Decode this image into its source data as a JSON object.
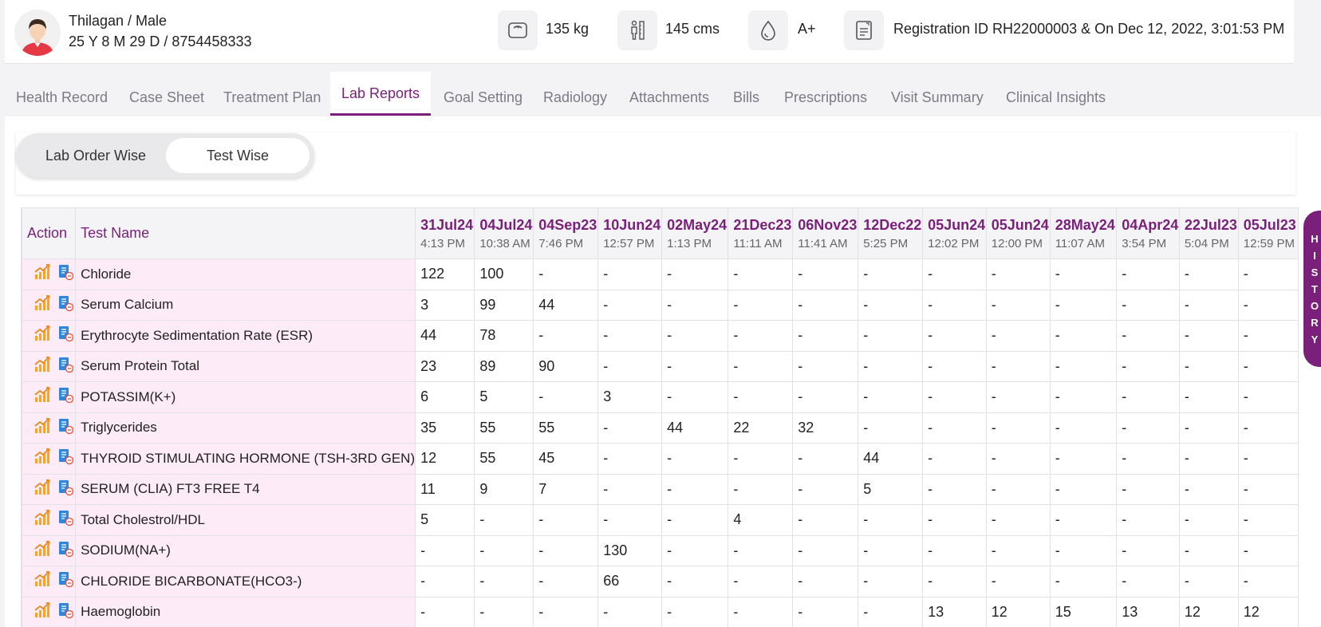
{
  "patient": {
    "name_gender": "Thilagan / Male",
    "age_phone": "25 Y 8 M 29 D / 8754458333"
  },
  "stats": {
    "weight": "135 kg",
    "height": "145 cms",
    "blood_group": "A+",
    "registration": "Registration ID RH22000003 & On Dec 12, 2022, 3:01:53 PM"
  },
  "tabs": [
    "Health Record",
    "Case Sheet",
    "Treatment Plan",
    "Lab Reports",
    "Goal Setting",
    "Radiology",
    "Attachments",
    "Bills",
    "Prescriptions",
    "Visit Summary",
    "Clinical Insights"
  ],
  "active_tab": "Lab Reports",
  "toggle": {
    "left": "Lab Order Wise",
    "right": "Test Wise",
    "selected": "Test Wise"
  },
  "table": {
    "action_header": "Action",
    "name_header": "Test Name",
    "dates": [
      {
        "date": "31Jul24",
        "time": "4:13 PM"
      },
      {
        "date": "04Jul24",
        "time": "10:38 AM"
      },
      {
        "date": "04Sep23",
        "time": "7:46 PM"
      },
      {
        "date": "10Jun24",
        "time": "12:57 PM"
      },
      {
        "date": "02May24",
        "time": "1:13 PM"
      },
      {
        "date": "21Dec23",
        "time": "11:11 AM"
      },
      {
        "date": "06Nov23",
        "time": "11:41 AM"
      },
      {
        "date": "12Dec22",
        "time": "5:25 PM"
      },
      {
        "date": "05Jun24",
        "time": "12:02 PM"
      },
      {
        "date": "05Jun24",
        "time": "12:00 PM"
      },
      {
        "date": "28May24",
        "time": "11:07 AM"
      },
      {
        "date": "04Apr24",
        "time": "3:54 PM"
      },
      {
        "date": "22Jul23",
        "time": "5:04 PM"
      },
      {
        "date": "05Jul23",
        "time": "12:59 PM"
      }
    ],
    "rows": [
      {
        "name": "Chloride",
        "values": [
          "122",
          "100",
          "-",
          "-",
          "-",
          "-",
          "-",
          "-",
          "-",
          "-",
          "-",
          "-",
          "-",
          "-"
        ]
      },
      {
        "name": "Serum Calcium",
        "values": [
          "3",
          "99",
          "44",
          "-",
          "-",
          "-",
          "-",
          "-",
          "-",
          "-",
          "-",
          "-",
          "-",
          "-"
        ]
      },
      {
        "name": "Erythrocyte Sedimentation Rate (ESR)",
        "values": [
          "44",
          "78",
          "-",
          "-",
          "-",
          "-",
          "-",
          "-",
          "-",
          "-",
          "-",
          "-",
          "-",
          "-"
        ]
      },
      {
        "name": "Serum Protein Total",
        "values": [
          "23",
          "89",
          "90",
          "-",
          "-",
          "-",
          "-",
          "-",
          "-",
          "-",
          "-",
          "-",
          "-",
          "-"
        ]
      },
      {
        "name": "POTASSIM(K+)",
        "values": [
          "6",
          "5",
          "-",
          "3",
          "-",
          "-",
          "-",
          "-",
          "-",
          "-",
          "-",
          "-",
          "-",
          "-"
        ]
      },
      {
        "name": "Triglycerides",
        "values": [
          "35",
          "55",
          "55",
          "-",
          "44",
          "22",
          "32",
          "-",
          "-",
          "-",
          "-",
          "-",
          "-",
          "-"
        ]
      },
      {
        "name": "THYROID STIMULATING HORMONE (TSH-3RD GEN)",
        "values": [
          "12",
          "55",
          "45",
          "-",
          "-",
          "-",
          "-",
          "44",
          "-",
          "-",
          "-",
          "-",
          "-",
          "-"
        ]
      },
      {
        "name": "SERUM (CLIA) FT3  FREE T4",
        "values": [
          "11",
          "9",
          "7",
          "-",
          "-",
          "-",
          "-",
          "5",
          "-",
          "-",
          "-",
          "-",
          "-",
          "-"
        ]
      },
      {
        "name": "Total Cholestrol/HDL",
        "values": [
          "5",
          "-",
          "-",
          "-",
          "-",
          "4",
          "-",
          "-",
          "-",
          "-",
          "-",
          "-",
          "-",
          "-"
        ]
      },
      {
        "name": "SODIUM(NA+)",
        "values": [
          "-",
          "-",
          "-",
          "130",
          "-",
          "-",
          "-",
          "-",
          "-",
          "-",
          "-",
          "-",
          "-",
          "-"
        ]
      },
      {
        "name": "CHLORIDE BICARBONATE(HCO3-)",
        "values": [
          "-",
          "-",
          "-",
          "66",
          "-",
          "-",
          "-",
          "-",
          "-",
          "-",
          "-",
          "-",
          "-",
          "-"
        ]
      },
      {
        "name": "Haemoglobin",
        "values": [
          "-",
          "-",
          "-",
          "-",
          "-",
          "-",
          "-",
          "-",
          "13",
          "12",
          "15",
          "13",
          "12",
          "12"
        ]
      }
    ]
  },
  "history_label": "HISTORY",
  "colors": {
    "accent": "#7a1f7a",
    "row_highlight": "#fdebf7",
    "chart_icon": "#f5a623",
    "report_icon": "#2e86de"
  }
}
